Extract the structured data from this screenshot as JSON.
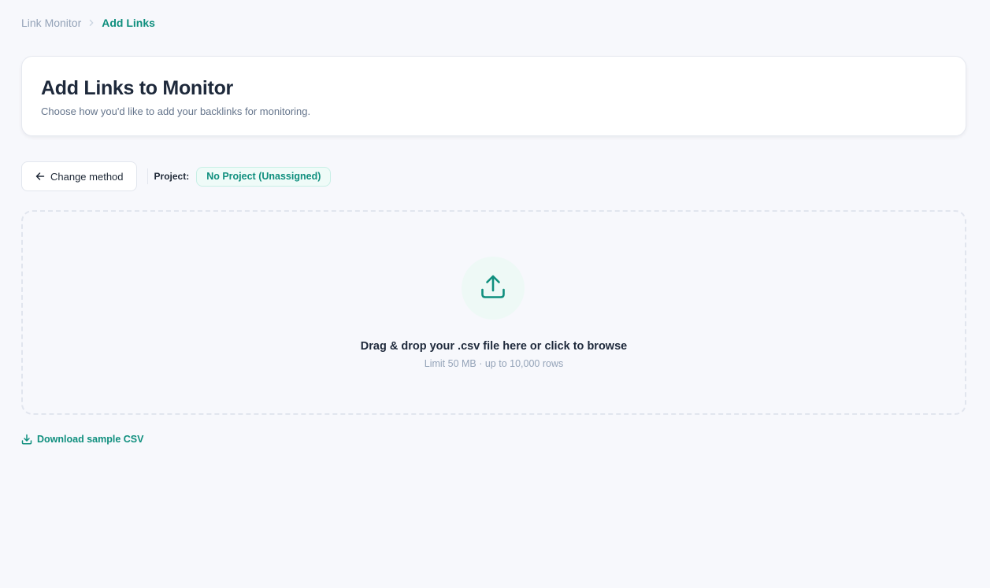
{
  "breadcrumb": {
    "parent": "Link Monitor",
    "current": "Add Links"
  },
  "header": {
    "title": "Add Links to Monitor",
    "subtitle": "Choose how you'd like to add your backlinks for monitoring."
  },
  "toolbar": {
    "change_method_label": "Change method",
    "project_label": "Project:",
    "project_value": "No Project (Unassigned)"
  },
  "dropzone": {
    "title": "Drag & drop your .csv file here or click to browse",
    "hint": "Limit 50 MB · up to 10,000 rows",
    "icon": "upload-icon"
  },
  "download": {
    "label": "Download sample CSV",
    "icon": "download-icon"
  },
  "colors": {
    "accent": "#0f8f7e",
    "background": "#f7f8fc",
    "muted": "#94a3b8"
  }
}
